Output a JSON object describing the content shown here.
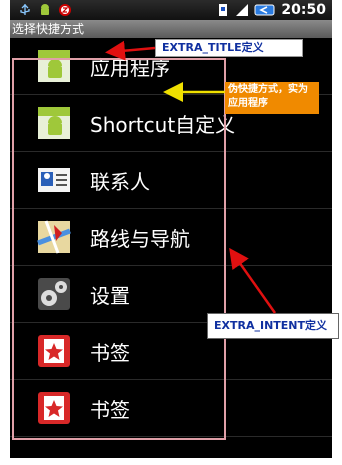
{
  "status_bar": {
    "time": "20:50",
    "icons": [
      "usb-icon",
      "android-debug-icon",
      "alarm-icon",
      "sim-icon",
      "signal-icon",
      "battery-icon"
    ]
  },
  "title_bar": {
    "title": "选择快捷方式"
  },
  "list": {
    "items": [
      {
        "label": "应用程序",
        "icon": "android-app-icon"
      },
      {
        "label": "Shortcut自定义",
        "icon": "android-app-icon"
      },
      {
        "label": "联系人",
        "icon": "contact-card-icon"
      },
      {
        "label": "路线与导航",
        "icon": "map-navigation-icon"
      },
      {
        "label": "设置",
        "icon": "settings-gear-icon"
      },
      {
        "label": "书签",
        "icon": "bookmark-star-icon"
      },
      {
        "label": "书签",
        "icon": "bookmark-star-icon"
      }
    ]
  },
  "annotations": {
    "extra_title": "EXTRA_TITLE定义",
    "fake_shortcut": "伪快捷方式，实为应用程序",
    "extra_intent": "EXTRA_INTENT定义"
  },
  "colors": {
    "annotation_arrow_red": "#e01010",
    "annotation_arrow_yellow": "#f0e000",
    "frame_pink": "#e0a0a8",
    "annotation_text_blue": "#1030a0",
    "annotation_orange": "#f08a00"
  }
}
